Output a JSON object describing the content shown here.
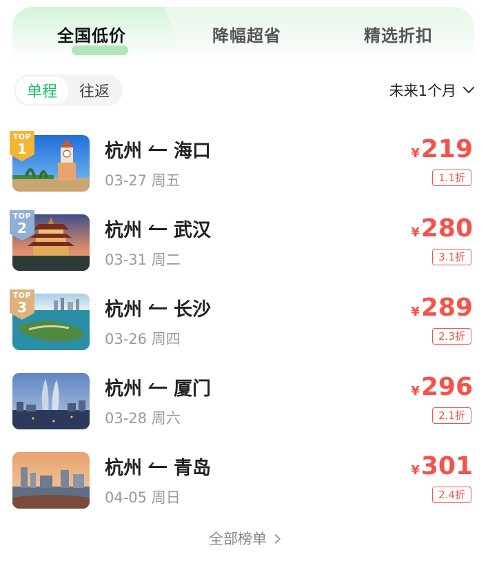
{
  "tabs": [
    {
      "label": "全国低价",
      "active": true
    },
    {
      "label": "降幅超省",
      "active": false
    },
    {
      "label": "精选折扣",
      "active": false
    }
  ],
  "trip_type": {
    "options": [
      "单程",
      "往返"
    ],
    "selected": "单程"
  },
  "period": {
    "label": "未来1个月",
    "icon": "chevron-down-icon"
  },
  "currency": "¥",
  "routes": [
    {
      "rank_label": "TOP",
      "rank": "1",
      "rank_color": "#f5b534",
      "from": "杭州",
      "to": "海口",
      "date": "03-27 周五",
      "price": "219",
      "discount": "1.1折",
      "scene": "haikou-clocktower"
    },
    {
      "rank_label": "TOP",
      "rank": "2",
      "rank_color": "#8fb0d6",
      "from": "杭州",
      "to": "武汉",
      "date": "03-31 周二",
      "price": "280",
      "discount": "3.1折",
      "scene": "wuhan-yellow-crane-tower"
    },
    {
      "rank_label": "TOP",
      "rank": "3",
      "rank_color": "#e0b27a",
      "from": "杭州",
      "to": "长沙",
      "date": "03-26 周四",
      "price": "289",
      "discount": "2.3折",
      "scene": "changsha-river-island"
    },
    {
      "rank_label": "",
      "rank": "",
      "rank_color": "",
      "from": "杭州",
      "to": "厦门",
      "date": "03-28 周六",
      "price": "296",
      "discount": "2.1折",
      "scene": "xiamen-twin-towers"
    },
    {
      "rank_label": "",
      "rank": "",
      "rank_color": "",
      "from": "杭州",
      "to": "青岛",
      "date": "04-05 周日",
      "price": "301",
      "discount": "2.4折",
      "scene": "qingdao-skyline"
    }
  ],
  "footer": {
    "more_label": "全部榜单",
    "icon": "chevron-right-icon"
  },
  "colors": {
    "accent_green": "#1fbf6b",
    "price_red": "#f5524a"
  }
}
